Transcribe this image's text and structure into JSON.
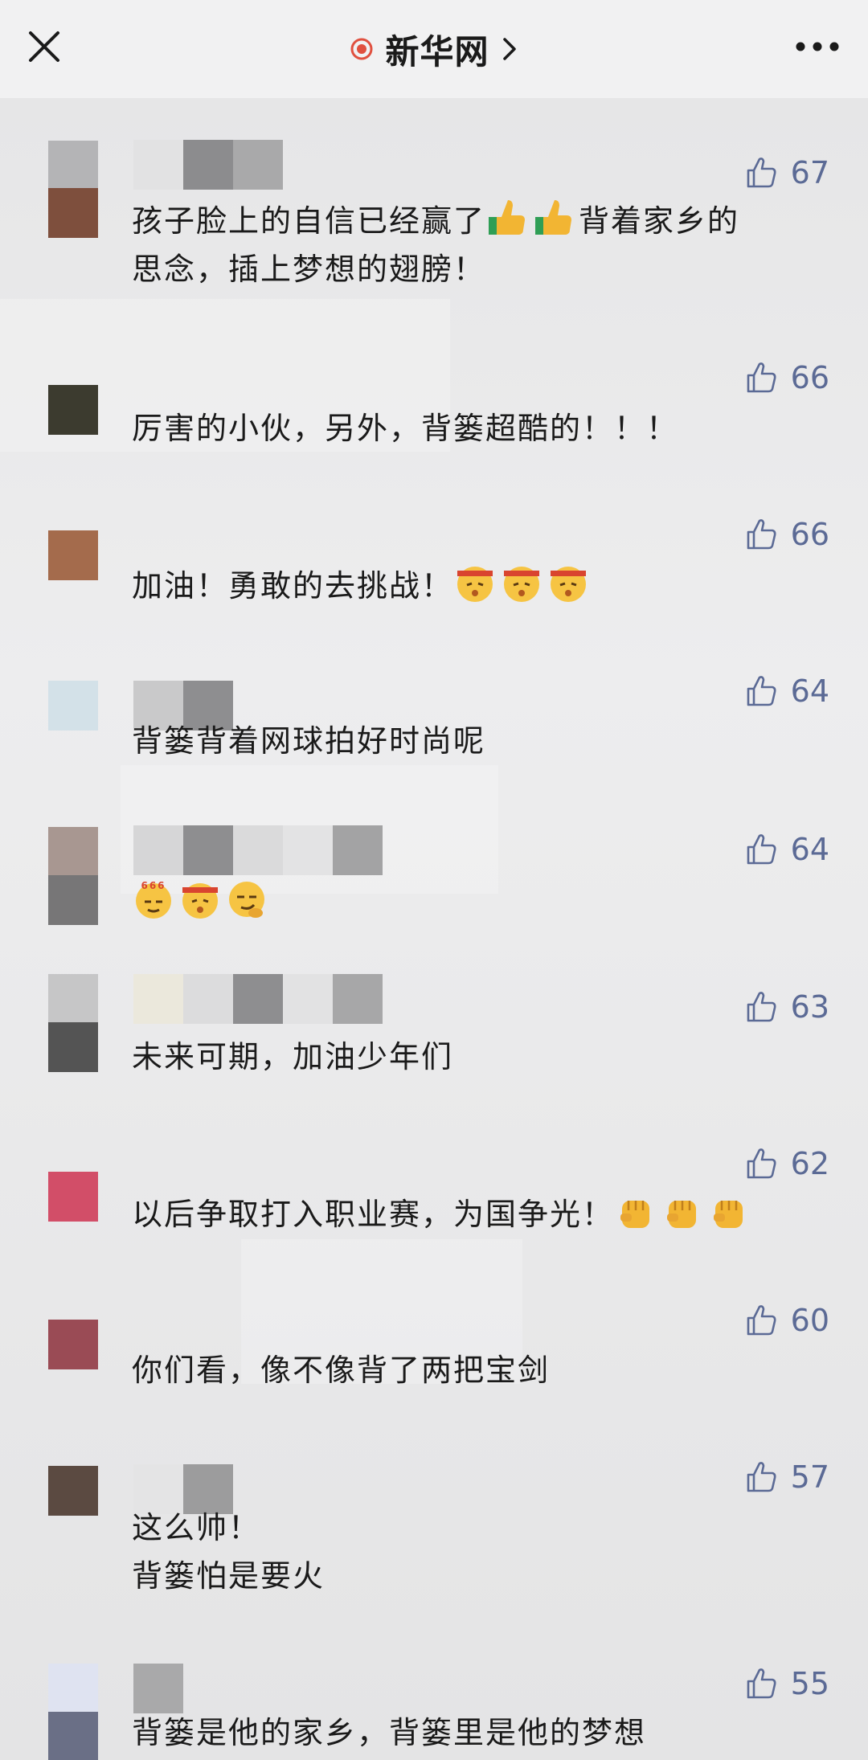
{
  "header": {
    "title": "新华网",
    "icons": {
      "close": "close-icon",
      "live": "live-dot-icon",
      "chevron": "chevron-right-icon",
      "more": "more-icon"
    }
  },
  "comments": [
    {
      "likes": "67",
      "text_a": "孩子脸上的自信已经赢了",
      "text_b": "背着家乡的\n思念，插上梦想的翅膀！",
      "emoji": [
        "thumbs-up-emoji",
        "thumbs-up-emoji"
      ]
    },
    {
      "likes": "66",
      "text": "厉害的小伙，另外，背篓超酷的！！！"
    },
    {
      "likes": "66",
      "text": "加油！勇敢的去挑战！",
      "emoji": [
        "fighting-emoji",
        "fighting-emoji",
        "fighting-emoji"
      ]
    },
    {
      "likes": "64",
      "text": "背篓背着网球拍好时尚呢"
    },
    {
      "likes": "64",
      "text": "",
      "emoji": [
        "666-emoji",
        "fighting-emoji",
        "smirk-emoji"
      ]
    },
    {
      "likes": "63",
      "text": "未来可期，加油少年们"
    },
    {
      "likes": "62",
      "text": "以后争取打入职业赛，为国争光！",
      "emoji": [
        "fist-emoji",
        "fist-emoji",
        "fist-emoji"
      ]
    },
    {
      "likes": "60",
      "text": "你们看，像不像背了两把宝剑"
    },
    {
      "likes": "57",
      "text": "这么帅！\n背篓怕是要火"
    },
    {
      "likes": "55",
      "text": "背篓是他的家乡，背篓里是他的梦想"
    }
  ],
  "colors": {
    "like": "#5b6a95",
    "live_dot": "#e0503f",
    "text": "#1a1a1a"
  }
}
